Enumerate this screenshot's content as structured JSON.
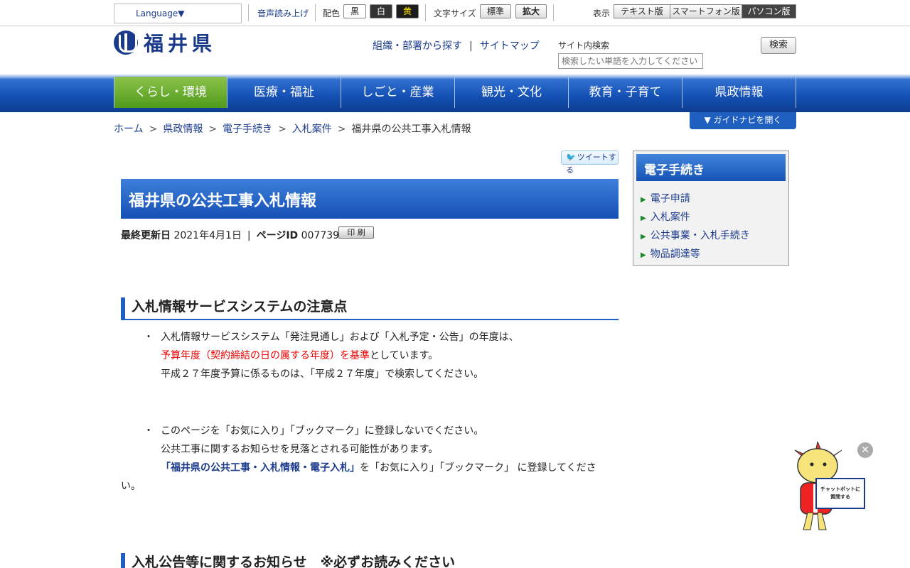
{
  "topbar": {
    "language": "Language▼",
    "voice": "音声読み上げ",
    "color_label": "配色",
    "colors": [
      "黒",
      "白",
      "黄"
    ],
    "font_label": "文字サイズ",
    "font_normal": "標準",
    "font_large": "拡大",
    "display_label": "表示",
    "display_text": "テキスト版",
    "display_smart": "スマートフォン版",
    "display_pc": "パソコン版"
  },
  "header": {
    "logo_text": "福井県",
    "link_org": "組織・部署から探す",
    "link_sep": "|",
    "link_sitemap": "サイトマップ",
    "search_label": "サイト内検索",
    "search_placeholder": "検索したい単語を入力してください",
    "search_button": "検索"
  },
  "nav": [
    {
      "label": "くらし・環境"
    },
    {
      "label": "医療・福祉"
    },
    {
      "label": "しごと・産業"
    },
    {
      "label": "観光・文化"
    },
    {
      "label": "教育・子育て"
    },
    {
      "label": "県政情報"
    }
  ],
  "breadcrumb": {
    "items": [
      "ホーム",
      "県政情報",
      "電子手続き",
      "入札案件"
    ],
    "arrow": ">",
    "current": "福井県の公共工事入札情報"
  },
  "guide_button": "▼ ガイドナビを開く",
  "tweet": "ツイートする",
  "page_title": "福井県の公共工事入札情報",
  "meta": {
    "updated_label": "最終更新日",
    "updated_value": "2021年4月1日",
    "sep": "|",
    "pageid_label": "ページID",
    "pageid_value": "007739",
    "print": "印 刷"
  },
  "section1": {
    "heading": "入札情報サービスシステムの注意点",
    "bullet": "・",
    "p1_line1": "入札情報サービスシステム「発注見通し」および「入札予定・公告」の年度は、",
    "p1_red": "予算年度（契約締結の日の属する年度）を基準",
    "p1_after_red": "としています。",
    "p1_line3": "平成２７年度予算に係るものは、「平成２７年度」で検索してください。",
    "p2_line1": "このページを「お気に入り」「ブックマーク」に登録しないでください。",
    "p2_line2": "公共工事に関するお知らせを見落とされる可能性があります。",
    "p2_link": "「福井県の公共工事・入札情報・電子入札」",
    "p2_after_link": "を「お気に入り」「ブックマーク」 に登録してくださ",
    "p2_wrap": "い。"
  },
  "section2": {
    "heading": "入札公告等に関するお知らせ　※必ずお読みください"
  },
  "sidebar": {
    "title": "電子手続き",
    "items": [
      "電子申請",
      "入札案件",
      "公共事業・入札手続き",
      "物品調達等"
    ]
  },
  "chatbot": {
    "sign_line1": "チャットボットに",
    "sign_line2": "質問する",
    "close": "✕"
  }
}
